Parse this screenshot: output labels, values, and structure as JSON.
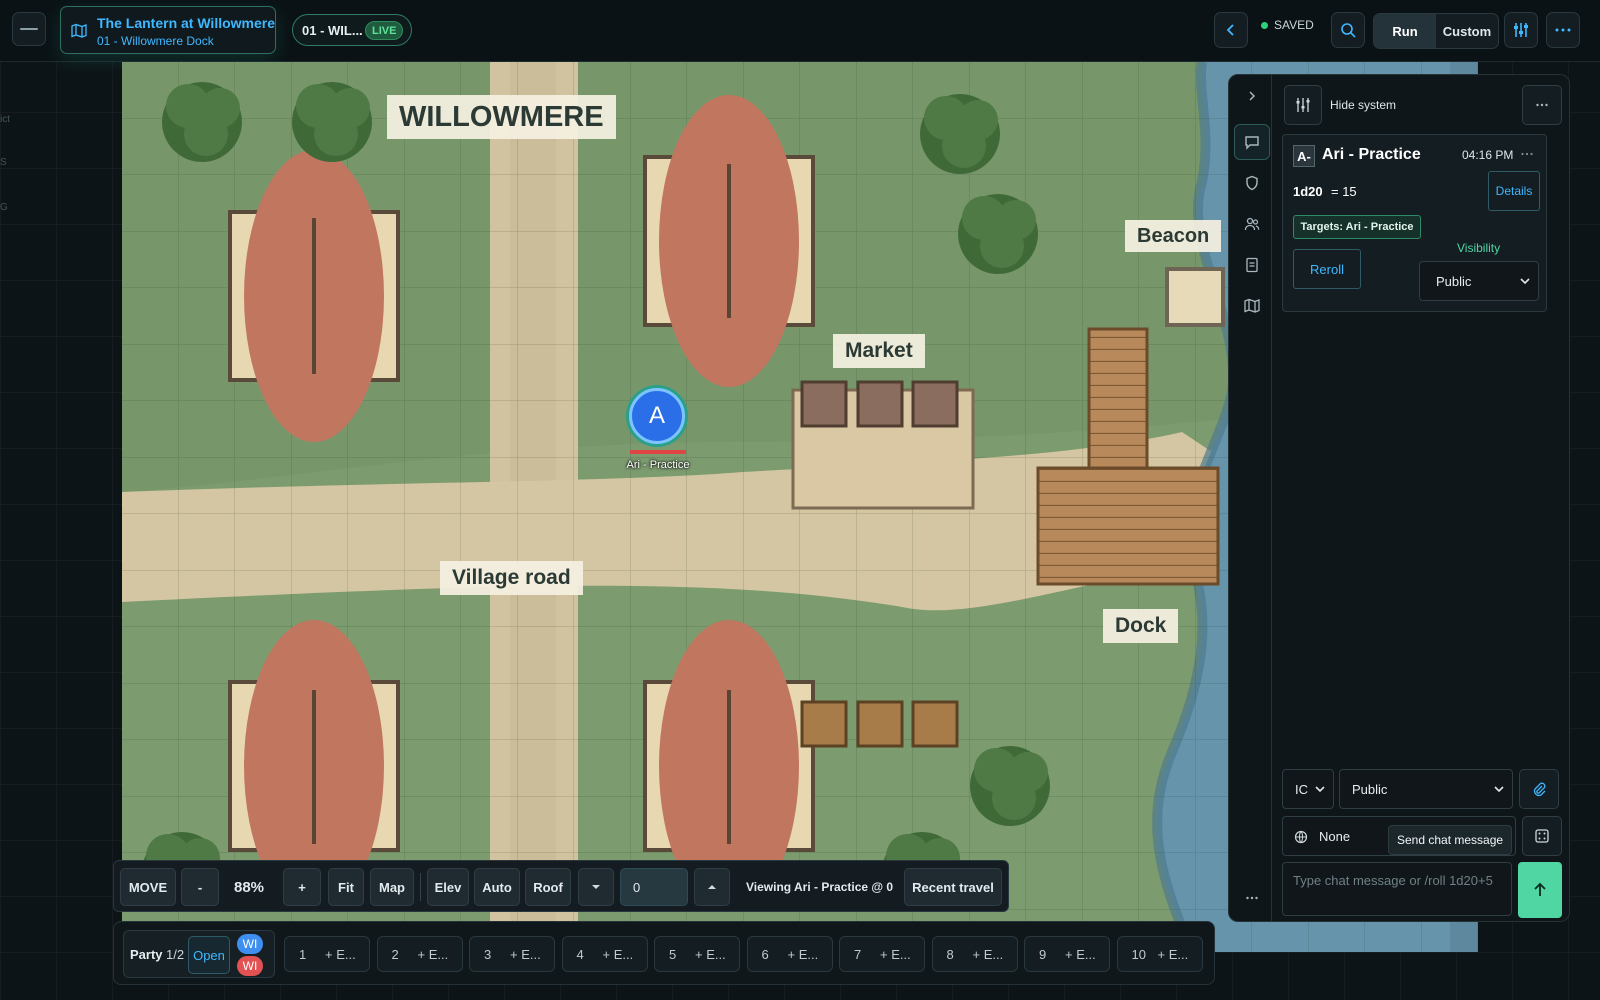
{
  "header": {
    "campaign_title": "The Lantern at Willowmere",
    "scene_subtitle": "01 - Willowmere Dock",
    "scene_pill": "01 - WIL...",
    "live_badge": "LIVE",
    "saved_label": "SAVED",
    "mode_run": "Run",
    "mode_custom": "Custom"
  },
  "map": {
    "labels": {
      "town": "WILLOWMERE",
      "market": "Market",
      "beacon": "Beacon",
      "road": "Village road",
      "dock": "Dock"
    },
    "token": {
      "initial": "A",
      "name": "Ari - Practice"
    }
  },
  "left_ghost": [
    "ict",
    "S",
    "G"
  ],
  "toolbar": {
    "mode": "MOVE",
    "zoom_minus": "-",
    "zoom": "88%",
    "zoom_plus": "+",
    "fit": "Fit",
    "map": "Map",
    "elev": "Elev",
    "auto": "Auto",
    "roof": "Roof",
    "elevation_value": "0",
    "viewing": "Viewing Ari - Practice @ 0",
    "recent_travel": "Recent travel"
  },
  "party": {
    "label": "Party",
    "count": "1/2",
    "open": "Open",
    "badges": [
      "WI",
      "WI"
    ],
    "slots": [
      {
        "num": "1",
        "rest": "+ E..."
      },
      {
        "num": "2",
        "rest": "+ E..."
      },
      {
        "num": "3",
        "rest": "+ E..."
      },
      {
        "num": "4",
        "rest": "+ E..."
      },
      {
        "num": "5",
        "rest": "+ E..."
      },
      {
        "num": "6",
        "rest": "+ E..."
      },
      {
        "num": "7",
        "rest": "+ E..."
      },
      {
        "num": "8",
        "rest": "+ E..."
      },
      {
        "num": "9",
        "rest": "+ E..."
      },
      {
        "num": "10",
        "rest": "+ E..."
      }
    ]
  },
  "panel": {
    "hide_system": "Hide system",
    "roll": {
      "avatar": "A-",
      "speaker": "Ari - Practice",
      "time": "04:16 PM",
      "formula": "1d20",
      "result": "= 15",
      "details": "Details",
      "targets": "Targets: Ari - Practice",
      "reroll": "Reroll",
      "visibility_label": "Visibility",
      "visibility_value": "Public"
    },
    "composer": {
      "mode": "IC",
      "channel": "Public",
      "speaker_as": "None",
      "tooltip": "Send chat message",
      "placeholder": "Type chat message or /roll 1d20+5"
    }
  },
  "colors": {
    "accent": "#3fb8ff",
    "send": "#4fd6a3",
    "grass": "#7a9a6e",
    "road": "#d4c6a2",
    "water": "#5d8ea6"
  }
}
